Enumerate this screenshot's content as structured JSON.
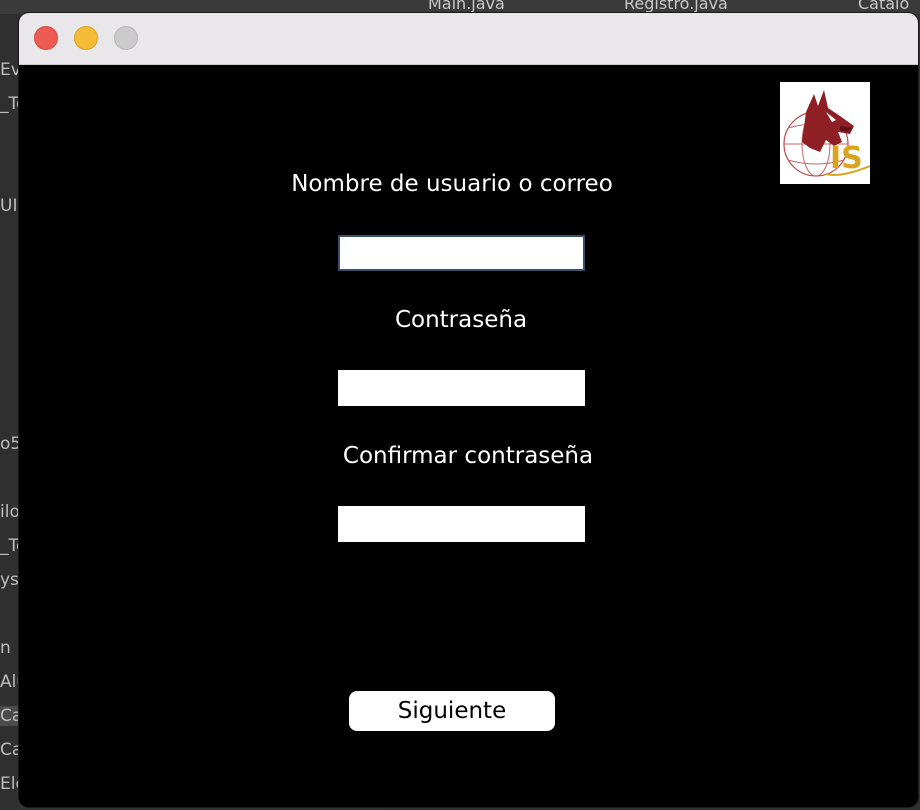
{
  "background_ide": {
    "tabs": [
      "Main.java",
      "Registro.java",
      "Catalo"
    ],
    "side_items": [
      "Ev",
      "_To",
      "UI",
      "o5",
      "ilo",
      "_To",
      "yst",
      "n",
      "Alu",
      "Ca",
      "Ca",
      "Ele"
    ]
  },
  "window": {
    "title": ""
  },
  "form": {
    "username_label": "Nombre de usuario o correo",
    "username_value": "",
    "password_label": "Contraseña",
    "password_value": "",
    "confirm_label": "Confirmar contraseña",
    "confirm_value": "",
    "next_button": "Siguiente"
  },
  "colors": {
    "content_bg": "#000000",
    "label_text": "#ffffff",
    "logo_red": "#8e1f24",
    "logo_gold": "#d9a51e"
  },
  "icons": {
    "logo": "wolf-globe-ist-logo"
  }
}
